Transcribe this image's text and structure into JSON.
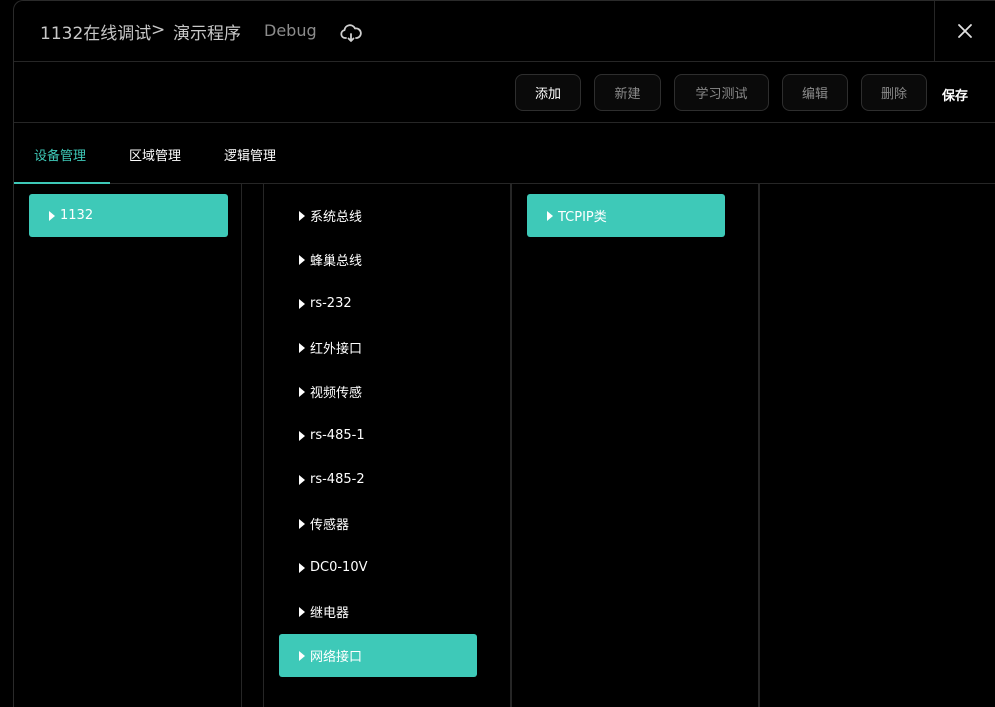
{
  "header": {
    "breadcrumb_root": "1132在线调试",
    "breadcrumb_sep": ">",
    "breadcrumb_page": "演示程序",
    "mode": "Debug",
    "cloud_icon": "cloud-sync-icon",
    "close_icon": "close-icon"
  },
  "toolbar": {
    "add": "添加",
    "new": "新建",
    "learn_test": "学习测试",
    "edit": "编辑",
    "delete": "删除",
    "save": "保存"
  },
  "tabs": [
    {
      "label": "设备管理",
      "active": true
    },
    {
      "label": "区域管理",
      "active": false
    },
    {
      "label": "逻辑管理",
      "active": false
    }
  ],
  "devices": [
    {
      "label": "1132",
      "selected": true
    }
  ],
  "interfaces": [
    {
      "label": "系统总线"
    },
    {
      "label": "蜂巢总线"
    },
    {
      "label": "rs-232"
    },
    {
      "label": "红外接口"
    },
    {
      "label": "视频传感"
    },
    {
      "label": "rs-485-1"
    },
    {
      "label": "rs-485-2"
    },
    {
      "label": "传感器"
    },
    {
      "label": "DC0-10V"
    },
    {
      "label": "继电器"
    },
    {
      "label": "网络接口",
      "selected": true
    }
  ],
  "types": [
    {
      "label": "TCPIP类",
      "selected": true
    }
  ],
  "colors": {
    "accent": "#3ec9b8",
    "background": "#000000",
    "border": "#262626"
  }
}
